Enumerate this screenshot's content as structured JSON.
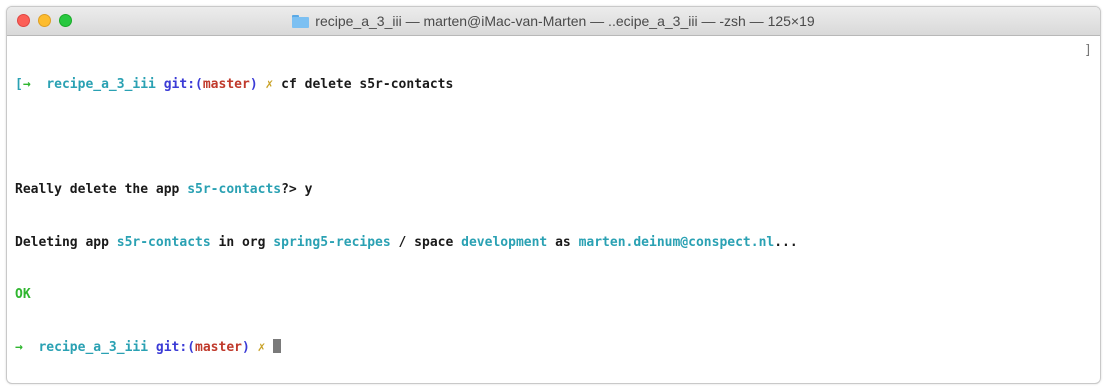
{
  "window": {
    "title": "recipe_a_3_iii — marten@iMac-van-Marten — ..ecipe_a_3_iii — -zsh — 125×19"
  },
  "terminal": {
    "line1": {
      "open_bracket": "[",
      "arrow": "→",
      "dir": "recipe_a_3_iii",
      "git": "git:(",
      "branch": "master",
      "git_close": ")",
      "x": "✗",
      "command": "cf delete s5r-contacts",
      "close_bracket": "]"
    },
    "line2": "",
    "line3": {
      "prefix": "Really delete the app ",
      "app": "s5r-contacts",
      "suffix": "?> y"
    },
    "line4": {
      "t1": "Deleting app ",
      "app": "s5r-contacts",
      "t2": " in org ",
      "org": "spring5-recipes",
      "t3": " / space ",
      "space": "development",
      "t4": " as ",
      "user": "marten.deinum@conspect.nl",
      "t5": "..."
    },
    "line5": "OK",
    "line6": {
      "arrow": "→",
      "dir": "recipe_a_3_iii",
      "git": "git:(",
      "branch": "master",
      "git_close": ")",
      "x": "✗"
    }
  }
}
